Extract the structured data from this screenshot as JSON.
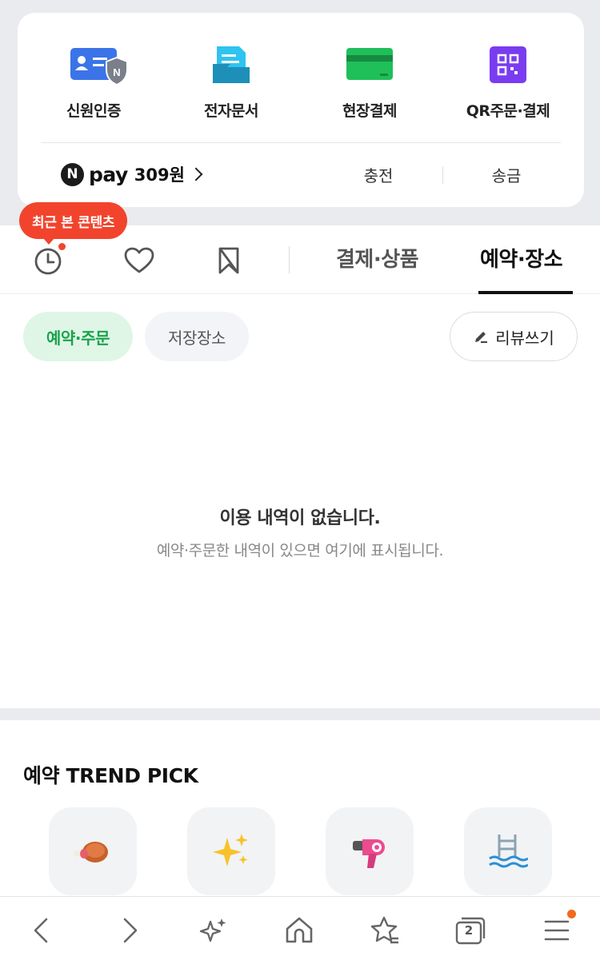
{
  "services": [
    {
      "label": "신원인증",
      "icon": "id-verify-icon"
    },
    {
      "label": "전자문서",
      "icon": "e-document-icon"
    },
    {
      "label": "현장결제",
      "icon": "card-payment-icon"
    },
    {
      "label": "QR주문·결제",
      "icon": "qr-order-icon"
    }
  ],
  "pay": {
    "badge": "N",
    "brand": "pay",
    "amount": "309원",
    "charge_label": "충전",
    "send_label": "송금"
  },
  "tooltip": "최근 본 콘텐츠",
  "tabs": {
    "payment": "결제·상품",
    "reservation": "예약·장소"
  },
  "filters": {
    "active": "예약·주문",
    "store": "저장장소",
    "review": "리뷰쓰기"
  },
  "empty": {
    "title": "이용 내역이 없습니다.",
    "description": "예약·주문한 내역이 있으면 여기에 표시됩니다."
  },
  "trend": {
    "title": "예약 TREND PICK",
    "items": [
      "meat-emoji",
      "sparkles-emoji",
      "hair-dryer-emoji",
      "swimming-pool-emoji"
    ]
  },
  "bottom_nav": {
    "tabs_count": "2"
  },
  "colors": {
    "accent_green": "#19a34b",
    "tooltip_red": "#f2442d",
    "notify_orange": "#f26a1b"
  }
}
